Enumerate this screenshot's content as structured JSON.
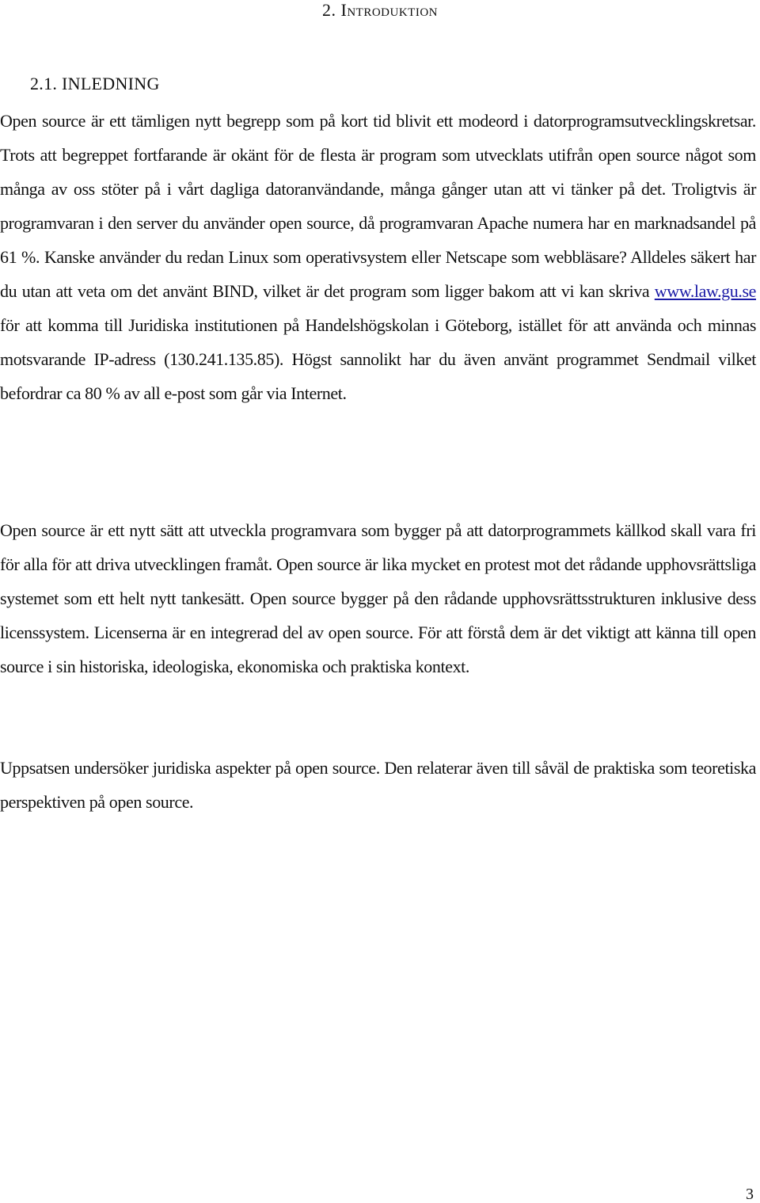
{
  "document": {
    "chapter_title": "2. Introduktion",
    "section_title": "2.1. INLEDNING",
    "paragraphs": [
      {
        "before_link": "Open source är ett tämligen nytt begrepp som på kort tid blivit ett modeord i datorprogramsutvecklingskretsar. Trots att begreppet fortfarande är okänt för de flesta är program som utvecklats utifrån open source något som många av oss stöter på i vårt dagliga datoranvändande, många gånger utan att vi tänker på det. Troligtvis är programvaran i den server du använder open source, då programvaran Apache numera har en marknadsandel på 61 %. Kanske använder du redan Linux som operativsystem eller Netscape som webbläsare? Alldeles säkert har du utan att veta om det använt BIND, vilket är det program som ligger bakom att vi kan skriva ",
        "link_text": "www.law.gu.se",
        "after_link": " för att komma till Juridiska institutionen på Handelshögskolan i Göteborg, istället för att använda och minnas motsvarande IP-adress (130.241.135.85). Högst sannolikt har du även använt programmet Sendmail vilket befordrar ca 80 % av all e-post som går via Internet."
      },
      {
        "text": "Open source är ett nytt sätt att utveckla programvara som bygger på att datorprogrammets källkod skall vara fri för alla för att driva utvecklingen framåt. Open source är lika mycket en protest mot det rådande upphovsrättsliga systemet som ett helt nytt tankesätt. Open source bygger på den rådande upphovsrättsstrukturen inklusive dess licenssystem. Licenserna är en integrerad del av open source. För att förstå dem är det viktigt att känna till open source i sin historiska, ideologiska, ekonomiska och praktiska kontext."
      },
      {
        "text": "Uppsatsen undersöker juridiska aspekter på open source. Den relaterar även till såväl de praktiska som teoretiska perspektiven på open source."
      }
    ],
    "page_number": "3",
    "link_color": "#1a1aa6"
  }
}
